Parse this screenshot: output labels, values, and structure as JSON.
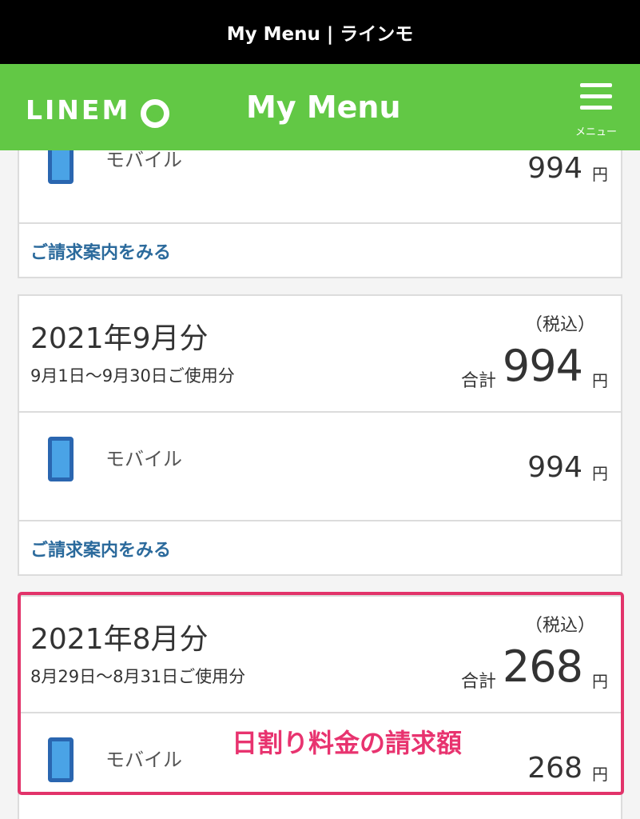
{
  "window_title": "My Menu | ラインモ",
  "header": {
    "logo": "LINEM",
    "title": "My Menu",
    "menu_label": "メニュー"
  },
  "cards": [
    {
      "line": {
        "name": "モバイル",
        "amount": "994",
        "unit": "円"
      },
      "link": "ご請求案内をみる"
    },
    {
      "month": "2021年9月分",
      "period": "9月1日〜9月30日ご使用分",
      "tax_note": "（税込）",
      "total_label": "合計",
      "total": "994",
      "unit": "円",
      "line": {
        "name": "モバイル",
        "amount": "994",
        "unit": "円"
      },
      "link": "ご請求案内をみる"
    },
    {
      "month": "2021年8月分",
      "period": "8月29日〜8月31日ご使用分",
      "tax_note": "（税込）",
      "total_label": "合計",
      "total": "268",
      "unit": "円",
      "line": {
        "name": "モバイル",
        "amount": "268",
        "unit": "円"
      }
    }
  ],
  "annotation": "日割り料金の請求額",
  "colors": {
    "brand_green": "#62c845",
    "link_blue": "#2b6a9c",
    "highlight_pink": "#e2336a"
  }
}
